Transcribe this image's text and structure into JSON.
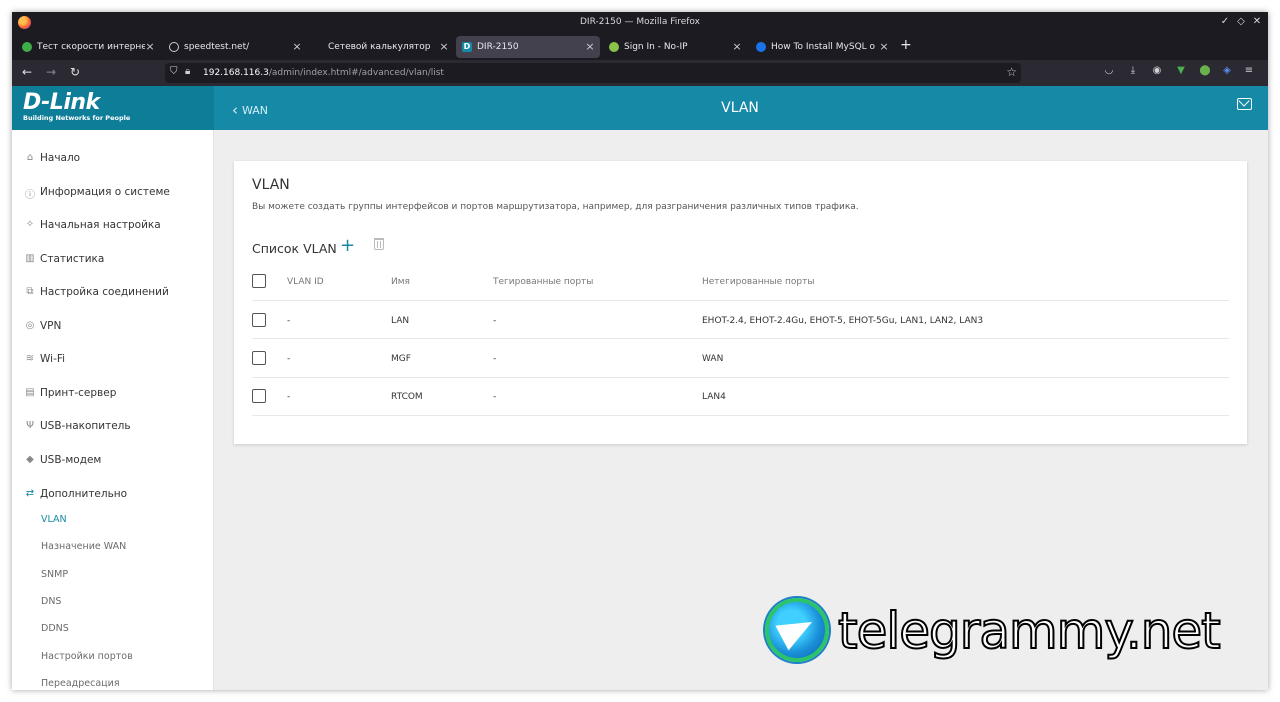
{
  "window": {
    "title": "DIR-2150 — Mozilla Firefox",
    "controls": [
      "✓",
      "◇",
      "✕"
    ]
  },
  "tabs": [
    {
      "label": "Тест скорости интернета",
      "icon_color": "#3fae4a",
      "icon": "speed-icon"
    },
    {
      "label": "speedtest.net/",
      "icon_color": "#555555",
      "icon": "speedtest-icon"
    },
    {
      "label": "Сетевой калькулятор",
      "icon_color": "",
      "icon": ""
    },
    {
      "label": "DIR-2150",
      "icon_color": "#1589a6",
      "icon": "dlink-icon",
      "active": true
    },
    {
      "label": "Sign In - No-IP",
      "icon_color": "#8bc34a",
      "icon": "noip-icon"
    },
    {
      "label": "How To Install MySQL on U",
      "icon_color": "#1a73e8",
      "icon": "digitalocean-icon"
    }
  ],
  "nav": {
    "url_host": "192.168.116.3",
    "url_path": "/admin/index.html#/advanced/vlan/list"
  },
  "router": {
    "brand": "D-Link",
    "tagline": "Building Networks for People",
    "back_label": "WAN",
    "header_title": "VLAN",
    "menu": [
      {
        "label": "Начало",
        "icon": "home-icon"
      },
      {
        "label": "Информация о системе",
        "icon": "info-icon"
      },
      {
        "label": "Начальная настройка",
        "icon": "wizard-icon"
      },
      {
        "label": "Статистика",
        "icon": "statistics-icon"
      },
      {
        "label": "Настройка соединений",
        "icon": "connections-icon"
      },
      {
        "label": "VPN",
        "icon": "vpn-icon"
      },
      {
        "label": "Wi-Fi",
        "icon": "wifi-icon"
      },
      {
        "label": "Принт-сервер",
        "icon": "printer-icon"
      },
      {
        "label": "USB-накопитель",
        "icon": "usb-icon"
      },
      {
        "label": "USB-модем",
        "icon": "modem-icon"
      },
      {
        "label": "Дополнительно",
        "icon": "advanced-icon"
      }
    ],
    "submenu": [
      {
        "label": "VLAN",
        "active": true
      },
      {
        "label": "Назначение WAN"
      },
      {
        "label": "SNMP"
      },
      {
        "label": "DNS"
      },
      {
        "label": "DDNS"
      },
      {
        "label": "Настройки портов"
      },
      {
        "label": "Переадресация"
      }
    ],
    "card": {
      "title": "VLAN",
      "description": "Вы можете создать группы интерфейсов и портов маршрутизатора, например, для разграничения различных типов трафика.",
      "list_title": "Список VLAN",
      "columns": [
        "VLAN ID",
        "Имя",
        "Тегированные порты",
        "Нетегированные порты"
      ],
      "rows": [
        [
          "-",
          "LAN",
          "-",
          "EHOT-2.4, EHOT-2.4Gu, EHOT-5, EHOT-5Gu, LAN1, LAN2, LAN3"
        ],
        [
          "-",
          "MGF",
          "-",
          "WAN"
        ],
        [
          "-",
          "RTCOM",
          "-",
          "LAN4"
        ]
      ]
    }
  },
  "watermark": "telegrammy.net"
}
